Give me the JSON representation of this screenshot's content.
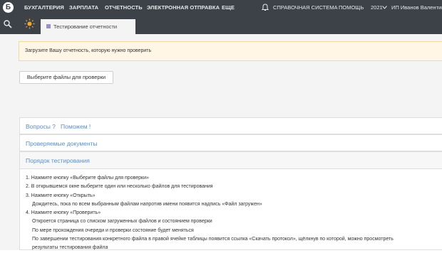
{
  "topbar": {
    "logo_letter": "Б",
    "nav": [
      "БУХГАЛТЕРИЯ",
      "ЗАРПЛАТА",
      "ОТЧЕТНОСТЬ",
      "ЭЛЕКТРОННАЯ ОТПРАВКА",
      "ЕЩЕ"
    ],
    "bell_icon": "bell-icon",
    "help_system": "СПРАВОЧНАЯ СИСТЕМА",
    "help": "ПОМОЩЬ",
    "year": "2021",
    "user": "ИП Иванов Валентин"
  },
  "tabbar": {
    "search_icon": "search-icon",
    "sun_icon": "sun-icon",
    "tab_label": "Тестирование отчетности"
  },
  "main": {
    "alert": "Загрузите Вашу отчетность, которую нужно проверить",
    "select_button": "Выберите файлы для проверки",
    "questions_label": "Вопросы ?",
    "help_link": "Поможем !",
    "checked_docs": "Проверяемые документы",
    "order_title": "Порядок тестирования",
    "steps": [
      "1. Нажмите кнопку «Выберите файлы для проверки»",
      "2. В открывшемся окне выберите один или несколько файлов для тестирования",
      "3. Нажмите кнопку «Открыть»",
      "Дождитесь, пока по всем выбранным файлам напротив имени появится надпись «Файл загружен»",
      "4. Нажмите кнопку «Проверить»",
      "Откроется страница со списком загруженных файлов и состоянием проверки",
      "По мере прохождения очереди и проверки состояние будет меняться",
      "По завершении тестирования конкретного файла в правой ячейке таблицы появится ссылка «Скачать протокол», щёлкнув по которой, можно просмотреть",
      "результаты тестирования файла"
    ]
  },
  "colors": {
    "topbar": "#3d4249",
    "accent_link": "#5b8ec4",
    "alert_bg": "#fff6e5",
    "sun": "#f5a623"
  }
}
